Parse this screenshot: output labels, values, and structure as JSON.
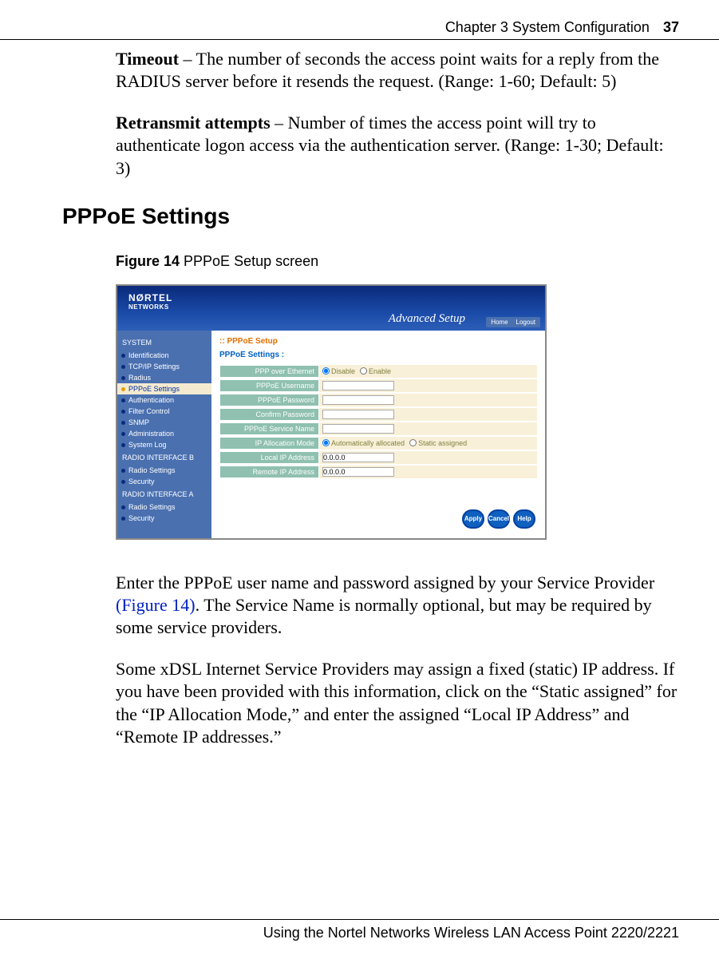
{
  "header": {
    "chapter": "Chapter 3  System Configuration",
    "page": "37"
  },
  "body": {
    "timeout_label": "Timeout",
    "timeout_text": " – The number of seconds the access point waits for a reply from the RADIUS server before it resends the request. (Range: 1-60; Default: 5)",
    "retrans_label": "Retransmit attempts",
    "retrans_text": " – Number of times the access point will try to authenticate logon access via the authentication server. (Range: 1-30; Default: 3)",
    "section_heading": "PPPoE Settings",
    "fig_caption_bold": "Figure 14",
    "fig_caption_rest": "   PPPoE Setup screen",
    "after_fig_1a": "Enter the PPPoE user name and password assigned by your Service Provider ",
    "after_fig_link": "(Figure 14)",
    "after_fig_1b": ". The Service Name is normally optional, but may be required by some service providers.",
    "after_fig_2": "Some xDSL Internet Service Providers may assign a fixed (static) IP address. If you have been provided with this information, click on the “Static assigned” for the “IP Allocation Mode,” and enter the assigned “Local IP Address” and “Remote IP addresses.”"
  },
  "figure": {
    "brand": "NØRTEL",
    "brand_sub": "NETWORKS",
    "adv": "Advanced Setup",
    "home": "Home",
    "logout": "Logout",
    "nav_system": "SYSTEM",
    "nav_items_sys": [
      "Identification",
      "TCP/IP Settings",
      "Radius",
      "PPPoE Settings",
      "Authentication",
      "Filter Control",
      "SNMP",
      "Administration",
      "System Log"
    ],
    "nav_radio_b": "RADIO INTERFACE B",
    "nav_items_b": [
      "Radio Settings",
      "Security"
    ],
    "nav_radio_a": "RADIO INTERFACE A",
    "nav_items_a": [
      "Radio Settings",
      "Security"
    ],
    "form_title": "PPPoE Setup",
    "form_sub": "PPPoE Settings :",
    "rows": {
      "ppp_over_eth": "PPP over Ethernet",
      "disable": "Disable",
      "enable": "Enable",
      "username": "PPPoE Username",
      "password": "PPPoE Password",
      "confirm": "Confirm Password",
      "service": "PPPoE Service Name",
      "ipmode": "IP Allocation Mode",
      "auto": "Automatically allocated",
      "static": "Static assigned",
      "local": "Local IP Address",
      "local_val": "0.0.0.0",
      "remote": "Remote IP Address",
      "remote_val": "0.0.0.0"
    },
    "btn_apply": "Apply",
    "btn_cancel": "Cancel",
    "btn_help": "Help"
  },
  "footer": "Using the Nortel Networks Wireless LAN Access Point 2220/2221"
}
